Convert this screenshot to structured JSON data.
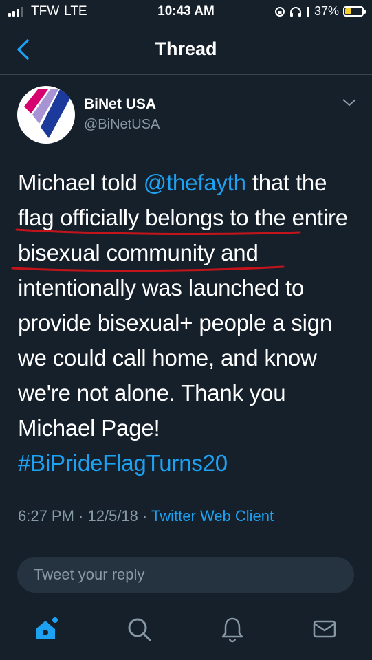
{
  "status_bar": {
    "carrier": "TFW",
    "network": "LTE",
    "time": "10:43 AM",
    "battery": "37%",
    "battery_level": 0.37
  },
  "nav": {
    "title": "Thread",
    "back_icon": "chevron-left-icon"
  },
  "tweet": {
    "name": "BiNet USA",
    "handle": "@BiNetUSA",
    "text_before_mention": "Michael told ",
    "mention": "@thefayth",
    "text_after_mention": " that the flag officially belongs to the entire bisexual community and intentionally was launched to provide bisexual+ people a sign we could call home, and know we're not alone. Thank you Michael Page!",
    "hashtag": "#BiPrideFlagTurns20",
    "timestamp": "6:27 PM · 12/5/18 · ",
    "client": "Twitter Web Client"
  },
  "reply": {
    "placeholder": "Tweet your reply"
  },
  "tabs": [
    "home-icon",
    "search-icon",
    "notifications-icon",
    "messages-icon"
  ],
  "colors": {
    "background": "#15202b",
    "accent": "#1da1f2",
    "underline": "#c4141b"
  }
}
